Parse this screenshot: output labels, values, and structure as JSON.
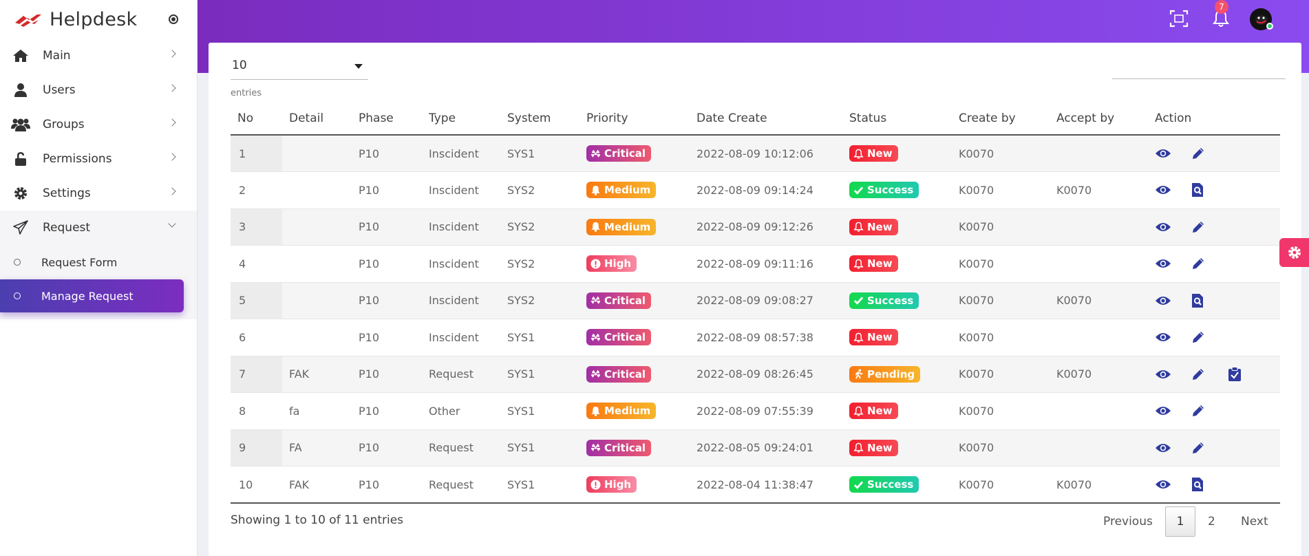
{
  "brand": {
    "title": "Helpdesk",
    "accent": "#d62b2b"
  },
  "sidebar": {
    "items": [
      {
        "label": "Main",
        "icon": "home-icon"
      },
      {
        "label": "Users",
        "icon": "user-icon"
      },
      {
        "label": "Groups",
        "icon": "users-icon"
      },
      {
        "label": "Permissions",
        "icon": "lock-icon"
      },
      {
        "label": "Settings",
        "icon": "gear-icon"
      },
      {
        "label": "Request",
        "icon": "paper-plane-icon"
      }
    ],
    "submenu": [
      {
        "label": "Request Form"
      },
      {
        "label": "Manage Request",
        "active": true
      }
    ]
  },
  "topbar": {
    "notification_count": "7"
  },
  "table_controls": {
    "page_length": "10",
    "entries_label": "entries"
  },
  "table": {
    "columns": [
      "No",
      "Detail",
      "Phase",
      "Type",
      "System",
      "Priority",
      "Date Create",
      "Status",
      "Create by",
      "Accept by",
      "Action"
    ],
    "rows": [
      {
        "no": "1",
        "detail": "",
        "phase": "P10",
        "type": "Inscident",
        "system": "SYS1",
        "priority": "Critical",
        "date": "2022-08-09 10:12:06",
        "status": "New",
        "create_by": "K0070",
        "accept_by": ""
      },
      {
        "no": "2",
        "detail": "",
        "phase": "P10",
        "type": "Inscident",
        "system": "SYS2",
        "priority": "Medium",
        "date": "2022-08-09 09:14:24",
        "status": "Success",
        "create_by": "K0070",
        "accept_by": "K0070"
      },
      {
        "no": "3",
        "detail": "",
        "phase": "P10",
        "type": "Inscident",
        "system": "SYS2",
        "priority": "Medium",
        "date": "2022-08-09 09:12:26",
        "status": "New",
        "create_by": "K0070",
        "accept_by": ""
      },
      {
        "no": "4",
        "detail": "",
        "phase": "P10",
        "type": "Inscident",
        "system": "SYS2",
        "priority": "High",
        "date": "2022-08-09 09:11:16",
        "status": "New",
        "create_by": "K0070",
        "accept_by": ""
      },
      {
        "no": "5",
        "detail": "",
        "phase": "P10",
        "type": "Inscident",
        "system": "SYS2",
        "priority": "Critical",
        "date": "2022-08-09 09:08:27",
        "status": "Success",
        "create_by": "K0070",
        "accept_by": "K0070"
      },
      {
        "no": "6",
        "detail": "",
        "phase": "P10",
        "type": "Inscident",
        "system": "SYS1",
        "priority": "Critical",
        "date": "2022-08-09 08:57:38",
        "status": "New",
        "create_by": "K0070",
        "accept_by": ""
      },
      {
        "no": "7",
        "detail": "FAK",
        "phase": "P10",
        "type": "Request",
        "system": "SYS1",
        "priority": "Critical",
        "date": "2022-08-09 08:26:45",
        "status": "Pending",
        "create_by": "K0070",
        "accept_by": "K0070"
      },
      {
        "no": "8",
        "detail": "fa",
        "phase": "P10",
        "type": "Other",
        "system": "SYS1",
        "priority": "Medium",
        "date": "2022-08-09 07:55:39",
        "status": "New",
        "create_by": "K0070",
        "accept_by": ""
      },
      {
        "no": "9",
        "detail": "FA",
        "phase": "P10",
        "type": "Request",
        "system": "SYS1",
        "priority": "Critical",
        "date": "2022-08-05 09:24:01",
        "status": "New",
        "create_by": "K0070",
        "accept_by": ""
      },
      {
        "no": "10",
        "detail": "FAK",
        "phase": "P10",
        "type": "Request",
        "system": "SYS1",
        "priority": "High",
        "date": "2022-08-04 11:38:47",
        "status": "Success",
        "create_by": "K0070",
        "accept_by": "K0070"
      }
    ]
  },
  "footer": {
    "info": "Showing 1 to 10 of 11 entries"
  },
  "pagination": {
    "previous": "Previous",
    "page1": "1",
    "page2": "2",
    "next": "Next"
  },
  "colors": {
    "primary": "#7b2cbf",
    "icon_blue": "#2f3b9e",
    "fab": "#f0366a"
  }
}
